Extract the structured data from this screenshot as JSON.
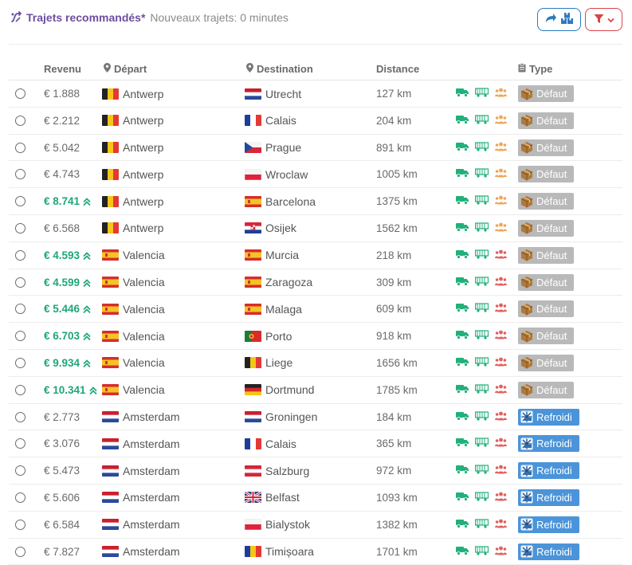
{
  "header": {
    "title": "Trajets recommandés*",
    "subtitle": "Nouveaux trajets: 0 minutes",
    "share_icon": "share-arrow-icon",
    "boxes_icon": "boxes-icon",
    "filter_icon": "filter-icon",
    "colors": {
      "title": "#6b4fa0",
      "share_border": "#2b7bbf",
      "filter_border": "#d9434b"
    }
  },
  "columns": {
    "revenue": "Revenu",
    "departure": "Départ",
    "destination": "Destination",
    "distance": "Distance",
    "type": "Type"
  },
  "colors": {
    "hot_revenue": "#1fa67a",
    "truck_icon": "#21b07a",
    "people_default": "#f0a55a",
    "people_cold": "#e0605e",
    "badge_default": "#b9b9b9",
    "badge_cold": "#4b94d9"
  },
  "rows": [
    {
      "revenue": "€ 1.888",
      "hot": false,
      "dep_flag": "be",
      "dep": "Antwerp",
      "dst_flag": "nl",
      "dst": "Utrecht",
      "distance": "127 km",
      "people": "orange",
      "type": "Défaut",
      "type_kind": "default"
    },
    {
      "revenue": "€ 2.212",
      "hot": false,
      "dep_flag": "be",
      "dep": "Antwerp",
      "dst_flag": "fr",
      "dst": "Calais",
      "distance": "204 km",
      "people": "orange",
      "type": "Défaut",
      "type_kind": "default"
    },
    {
      "revenue": "€ 5.042",
      "hot": false,
      "dep_flag": "be",
      "dep": "Antwerp",
      "dst_flag": "cz",
      "dst": "Prague",
      "distance": "891 km",
      "people": "orange",
      "type": "Défaut",
      "type_kind": "default"
    },
    {
      "revenue": "€ 4.743",
      "hot": false,
      "dep_flag": "be",
      "dep": "Antwerp",
      "dst_flag": "pl",
      "dst": "Wroclaw",
      "distance": "1005 km",
      "people": "orange",
      "type": "Défaut",
      "type_kind": "default"
    },
    {
      "revenue": "€ 8.741",
      "hot": true,
      "dep_flag": "be",
      "dep": "Antwerp",
      "dst_flag": "es",
      "dst": "Barcelona",
      "distance": "1375 km",
      "people": "orange",
      "type": "Défaut",
      "type_kind": "default"
    },
    {
      "revenue": "€ 6.568",
      "hot": false,
      "dep_flag": "be",
      "dep": "Antwerp",
      "dst_flag": "hr",
      "dst": "Osijek",
      "distance": "1562 km",
      "people": "orange",
      "type": "Défaut",
      "type_kind": "default"
    },
    {
      "revenue": "€ 4.593",
      "hot": true,
      "dep_flag": "es",
      "dep": "Valencia",
      "dst_flag": "es",
      "dst": "Murcia",
      "distance": "218 km",
      "people": "red",
      "type": "Défaut",
      "type_kind": "default"
    },
    {
      "revenue": "€ 4.599",
      "hot": true,
      "dep_flag": "es",
      "dep": "Valencia",
      "dst_flag": "es",
      "dst": "Zaragoza",
      "distance": "309 km",
      "people": "red",
      "type": "Défaut",
      "type_kind": "default"
    },
    {
      "revenue": "€ 5.446",
      "hot": true,
      "dep_flag": "es",
      "dep": "Valencia",
      "dst_flag": "es",
      "dst": "Malaga",
      "distance": "609 km",
      "people": "red",
      "type": "Défaut",
      "type_kind": "default"
    },
    {
      "revenue": "€ 6.703",
      "hot": true,
      "dep_flag": "es",
      "dep": "Valencia",
      "dst_flag": "pt",
      "dst": "Porto",
      "distance": "918 km",
      "people": "red",
      "type": "Défaut",
      "type_kind": "default"
    },
    {
      "revenue": "€ 9.934",
      "hot": true,
      "dep_flag": "es",
      "dep": "Valencia",
      "dst_flag": "be",
      "dst": "Liege",
      "distance": "1656 km",
      "people": "red",
      "type": "Défaut",
      "type_kind": "default"
    },
    {
      "revenue": "€ 10.341",
      "hot": true,
      "dep_flag": "es",
      "dep": "Valencia",
      "dst_flag": "de",
      "dst": "Dortmund",
      "distance": "1785 km",
      "people": "red",
      "type": "Défaut",
      "type_kind": "default"
    },
    {
      "revenue": "€ 2.773",
      "hot": false,
      "dep_flag": "nl",
      "dep": "Amsterdam",
      "dst_flag": "nl",
      "dst": "Groningen",
      "distance": "184 km",
      "people": "red",
      "type": "Refroidi",
      "type_kind": "cold"
    },
    {
      "revenue": "€ 3.076",
      "hot": false,
      "dep_flag": "nl",
      "dep": "Amsterdam",
      "dst_flag": "fr",
      "dst": "Calais",
      "distance": "365 km",
      "people": "red",
      "type": "Refroidi",
      "type_kind": "cold"
    },
    {
      "revenue": "€ 5.473",
      "hot": false,
      "dep_flag": "nl",
      "dep": "Amsterdam",
      "dst_flag": "at",
      "dst": "Salzburg",
      "distance": "972 km",
      "people": "red",
      "type": "Refroidi",
      "type_kind": "cold"
    },
    {
      "revenue": "€ 5.606",
      "hot": false,
      "dep_flag": "nl",
      "dep": "Amsterdam",
      "dst_flag": "gb",
      "dst": "Belfast",
      "distance": "1093 km",
      "people": "red",
      "type": "Refroidi",
      "type_kind": "cold"
    },
    {
      "revenue": "€ 6.584",
      "hot": false,
      "dep_flag": "nl",
      "dep": "Amsterdam",
      "dst_flag": "pl",
      "dst": "Bialystok",
      "distance": "1382 km",
      "people": "red",
      "type": "Refroidi",
      "type_kind": "cold"
    },
    {
      "revenue": "€ 7.827",
      "hot": false,
      "dep_flag": "nl",
      "dep": "Amsterdam",
      "dst_flag": "ro",
      "dst": "Timișoara",
      "distance": "1701 km",
      "people": "red",
      "type": "Refroidi",
      "type_kind": "cold"
    }
  ]
}
